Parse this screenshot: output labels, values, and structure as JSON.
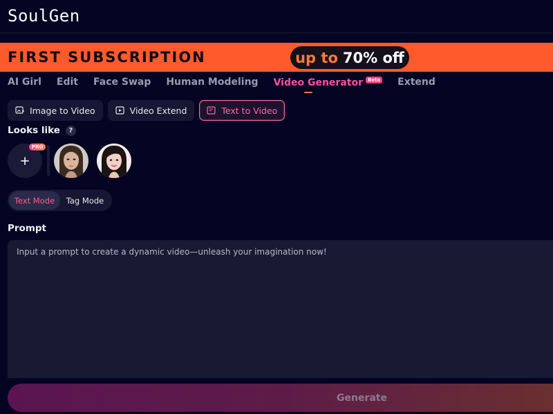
{
  "app": {
    "logo": "SoulGen"
  },
  "banner": {
    "title": "FIRST SUBSCRIPTION",
    "pill_prefix": "up to",
    "pill_discount": "70% off"
  },
  "nav": {
    "items": [
      {
        "label": "AI Girl"
      },
      {
        "label": "Edit"
      },
      {
        "label": "Face Swap"
      },
      {
        "label": "Human Modeling"
      },
      {
        "label": "Video Generator",
        "badge": "Beta",
        "active": true
      },
      {
        "label": "Extend"
      }
    ]
  },
  "subtabs": {
    "items": [
      {
        "label": "Image to Video"
      },
      {
        "label": "Video Extend"
      },
      {
        "label": "Text to Video",
        "active": true
      }
    ]
  },
  "looks": {
    "label": "Looks like",
    "help": "?",
    "add": "+",
    "pro_badge": "PRO"
  },
  "mode_toggle": {
    "text_mode": "Text Mode",
    "tag_mode": "Tag Mode",
    "selected": "Text Mode"
  },
  "prompt": {
    "label": "Prompt",
    "placeholder": "Input a prompt to create a dynamic video—unleash your imagination now!",
    "value": ""
  },
  "generate": {
    "label": "Generate"
  },
  "colors": {
    "background": "#050523",
    "banner": "#ff5a2b",
    "accent_pink": "#ff4fa0",
    "accent_orange": "#ff7a3a",
    "panel": "#191933"
  }
}
